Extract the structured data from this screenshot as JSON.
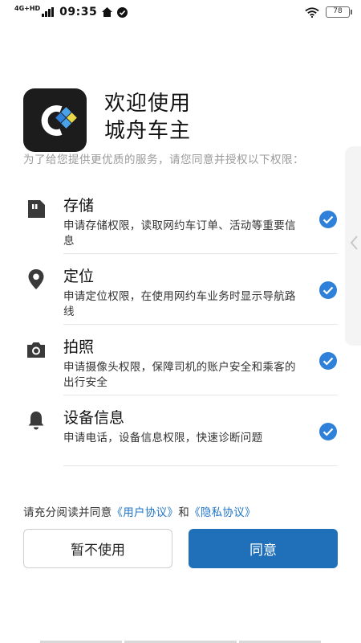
{
  "status_bar": {
    "network": "4G+HD",
    "time": "09:35",
    "battery": "78"
  },
  "header": {
    "welcome_line1": "欢迎使用",
    "welcome_line2": "城舟车主"
  },
  "intro_text": "为了给您提供更优质的服务，请您同意并授权以下权限：",
  "permissions": [
    {
      "icon": "sd-card-icon",
      "title": "存储",
      "description": "申请存储权限，读取网约车订单、活动等重要信息",
      "checked": true
    },
    {
      "icon": "location-pin-icon",
      "title": "定位",
      "description": "申请定位权限，在使用网约车业务时显示导航路线",
      "checked": true
    },
    {
      "icon": "camera-icon",
      "title": "拍照",
      "description": "申请摄像头权限，保障司机的账户安全和乘客的出行安全",
      "checked": true
    },
    {
      "icon": "bell-icon",
      "title": "设备信息",
      "description": "申请电话，设备信息权限，快速诊断问题",
      "checked": true
    }
  ],
  "agreement": {
    "prefix": "请充分阅读并同意",
    "user_agreement": "《用户协议》",
    "conjunction": "和",
    "privacy_policy": "《隐私协议》"
  },
  "buttons": {
    "decline": "暂不使用",
    "agree": "同意"
  },
  "colors": {
    "accent": "#1f6fb9",
    "link": "#1f74c8",
    "check": "#2f80d8",
    "logo_bg": "#1c1c1c"
  }
}
